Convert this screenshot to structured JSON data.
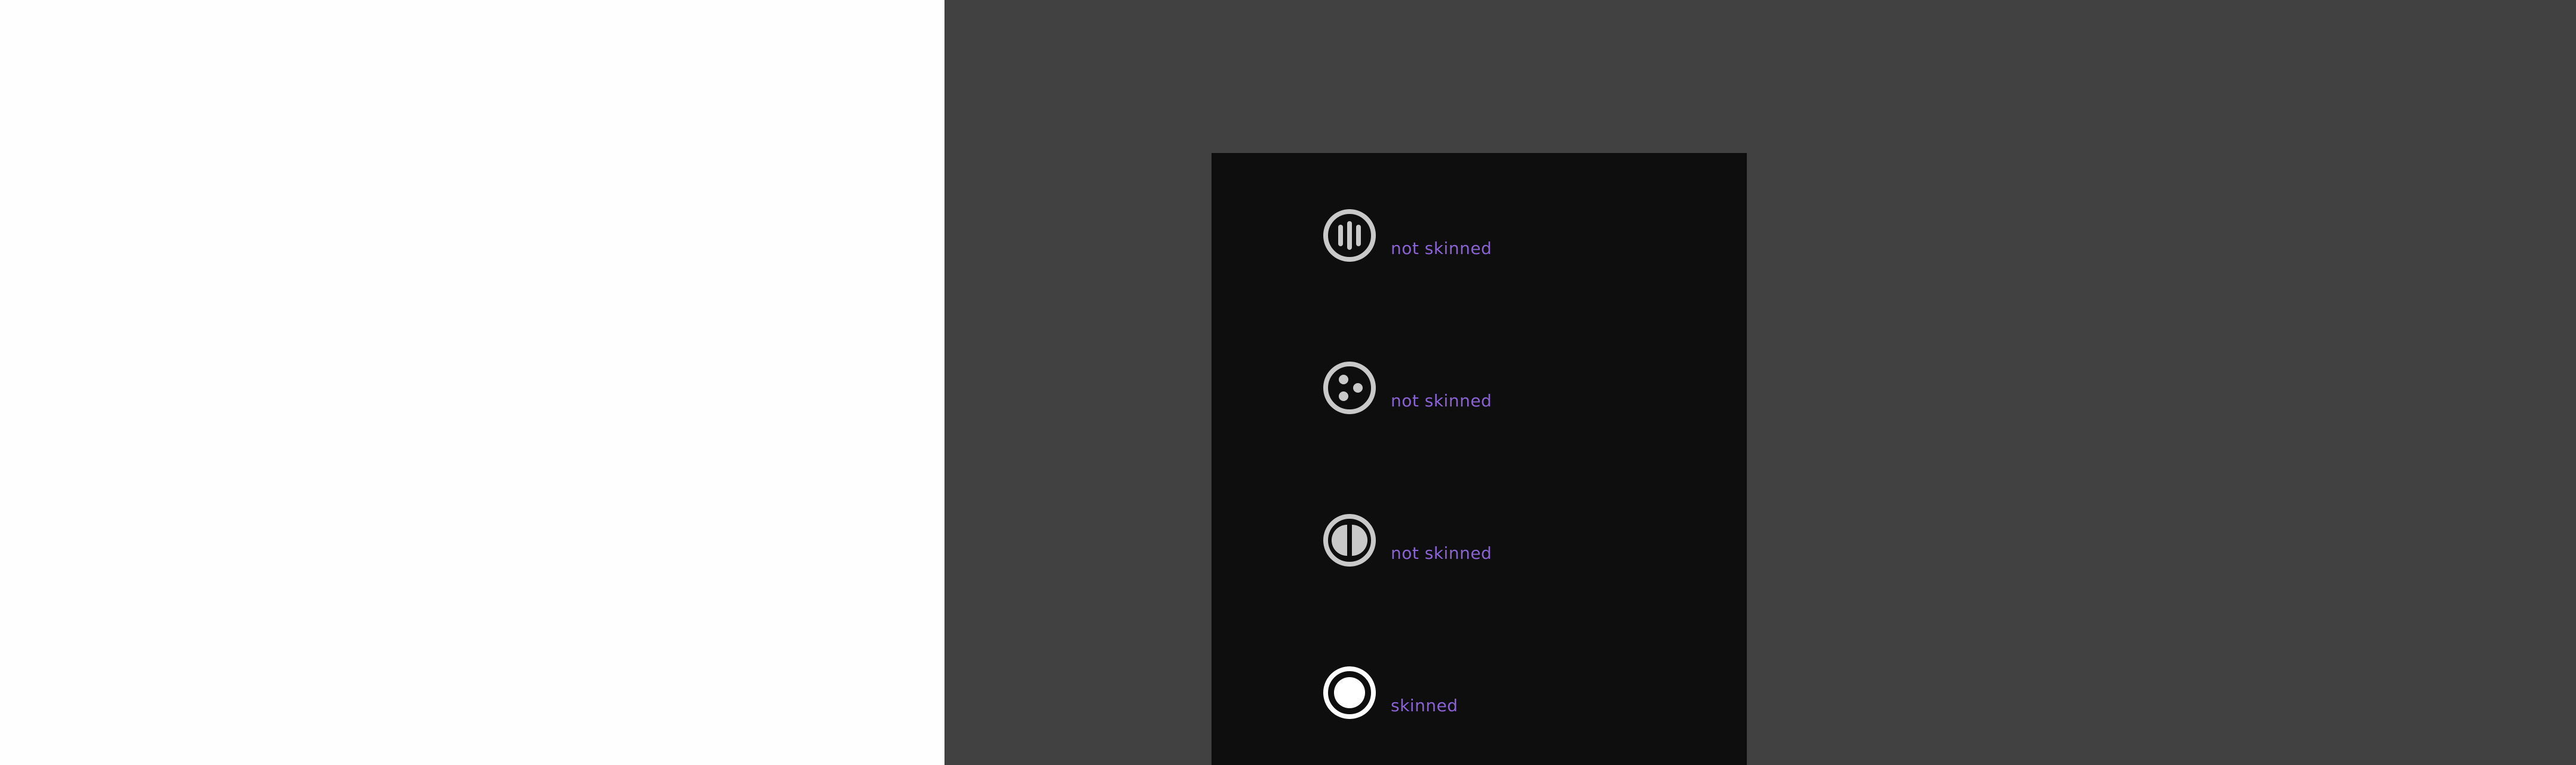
{
  "colors": {
    "left_background": "#fefefe",
    "right_background": "#414141",
    "panel_background": "#0e0e0e",
    "label_color": "#8a63d2",
    "icon_unskinned": "#c9c9c9",
    "icon_skinned": "#ffffff"
  },
  "items": [
    {
      "icon": "pause-bars-icon",
      "label": "not skinned",
      "skinned": false
    },
    {
      "icon": "three-dots-icon",
      "label": "not skinned",
      "skinned": false
    },
    {
      "icon": "half-circle-icon",
      "label": "not skinned",
      "skinned": false
    },
    {
      "icon": "filled-circle-icon",
      "label": "skinned",
      "skinned": true
    }
  ]
}
